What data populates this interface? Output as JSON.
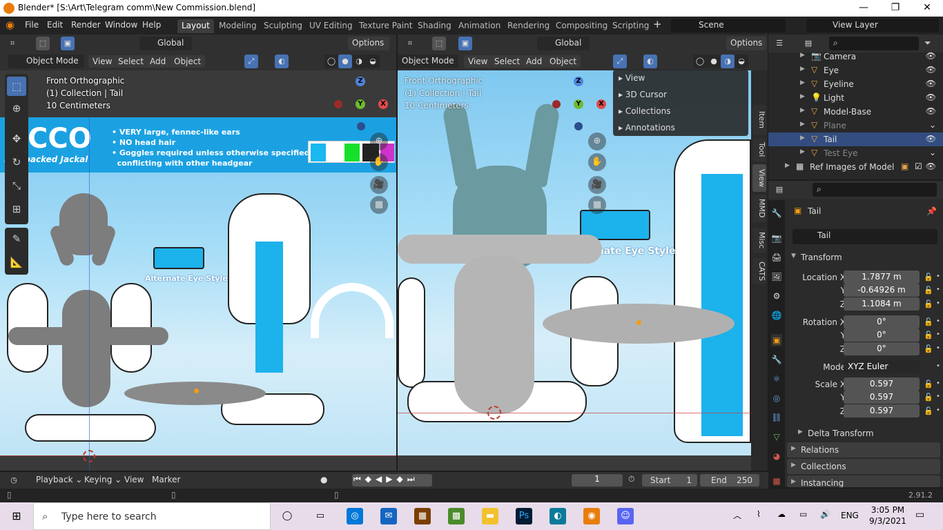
{
  "window": {
    "title": "Blender* [S:\\Art\\Telegram comm\\New Commission.blend]",
    "minimize": "—",
    "maximize": "❐",
    "close": "✕"
  },
  "menu": {
    "file": "File",
    "edit": "Edit",
    "render": "Render",
    "window": "Window",
    "help": "Help"
  },
  "workspaces": [
    "Layout",
    "Modeling",
    "Sculpting",
    "UV Editing",
    "Texture Paint",
    "Shading",
    "Animation",
    "Rendering",
    "Compositing",
    "Scripting"
  ],
  "active_workspace": "Layout",
  "scene": "Scene",
  "view_layer": "View Layer",
  "left_viewport": {
    "orientation": "Global",
    "options": "Options",
    "mode": "Object Mode",
    "menus": [
      "View",
      "Select",
      "Add",
      "Object"
    ],
    "overlay": {
      "view": "Front Orthographic",
      "collection": "(1) Collection | Tail",
      "scale": "10 Centimeters"
    },
    "ref_text": {
      "brand": "OCCO",
      "subtitle": "ked-backed Jackal",
      "bullets": [
        "• VERY large, fennec-like ears",
        "• NO head hair",
        "• Goggles required unless otherwise specified or",
        "  conflicting with other headgear"
      ],
      "alt_eye": "Alternate Eye Style"
    }
  },
  "right_viewport": {
    "orientation": "Global",
    "options": "Options",
    "mode": "Object Mode",
    "menus": [
      "View",
      "Select",
      "Add",
      "Object"
    ],
    "overlay": {
      "view": "Front Orthographic",
      "collection": "(1) Collection | Tail",
      "scale": "10 Centimeters"
    },
    "alt_eye": "Alternate Eye Style",
    "npanel_items": [
      "View",
      "3D Cursor",
      "Collections",
      "Annotations"
    ],
    "side_tabs": [
      "Item",
      "Tool",
      "View",
      "MMD",
      "Misc",
      "CATS"
    ]
  },
  "axes": {
    "z": "Z",
    "y": "Y",
    "x": "X"
  },
  "outliner": {
    "items": [
      {
        "name": "Camera",
        "icon": "camera-icon",
        "dim": false
      },
      {
        "name": "Eye",
        "icon": "mesh-icon",
        "dim": false
      },
      {
        "name": "Eyeline",
        "icon": "mesh-icon",
        "dim": false
      },
      {
        "name": "Light",
        "icon": "light-icon",
        "dim": false
      },
      {
        "name": "Model-Base",
        "icon": "mesh-icon",
        "dim": false
      },
      {
        "name": "Plane",
        "icon": "mesh-icon",
        "dim": true
      },
      {
        "name": "Tail",
        "icon": "mesh-icon",
        "dim": false
      },
      {
        "name": "Test Eye",
        "icon": "mesh-icon",
        "dim": true
      }
    ],
    "collection": "Ref Images of Model"
  },
  "properties": {
    "object_name": "Tail",
    "datablock": "Tail",
    "transform": "Transform",
    "location_x_label": "Location X",
    "location_x": "1.7877 m",
    "location_y_label": "Y",
    "location_y": "-0.64926 m",
    "location_z_label": "Z",
    "location_z": "1.1084 m",
    "rotation_x_label": "Rotation X",
    "rotation_x": "0°",
    "rotation_y_label": "Y",
    "rotation_y": "0°",
    "rotation_z_label": "Z",
    "rotation_z": "0°",
    "mode_label": "Mode",
    "mode": "XYZ Euler",
    "scale_x_label": "Scale X",
    "scale_x": "0.597",
    "scale_y_label": "Y",
    "scale_y": "0.597",
    "scale_z_label": "Z",
    "scale_z": "0.597",
    "delta": "Delta Transform",
    "relations": "Relations",
    "collections": "Collections",
    "instancing": "Instancing"
  },
  "timeline": {
    "playback": "Playback",
    "keying": "Keying",
    "view": "View",
    "marker": "Marker",
    "frame": "1",
    "start_label": "Start",
    "start": "1",
    "end_label": "End",
    "end": "250"
  },
  "version": "2.91.2",
  "taskbar": {
    "search": "Type here to search",
    "lang": "ENG",
    "time": "3:05 PM",
    "date": "9/3/2021"
  }
}
